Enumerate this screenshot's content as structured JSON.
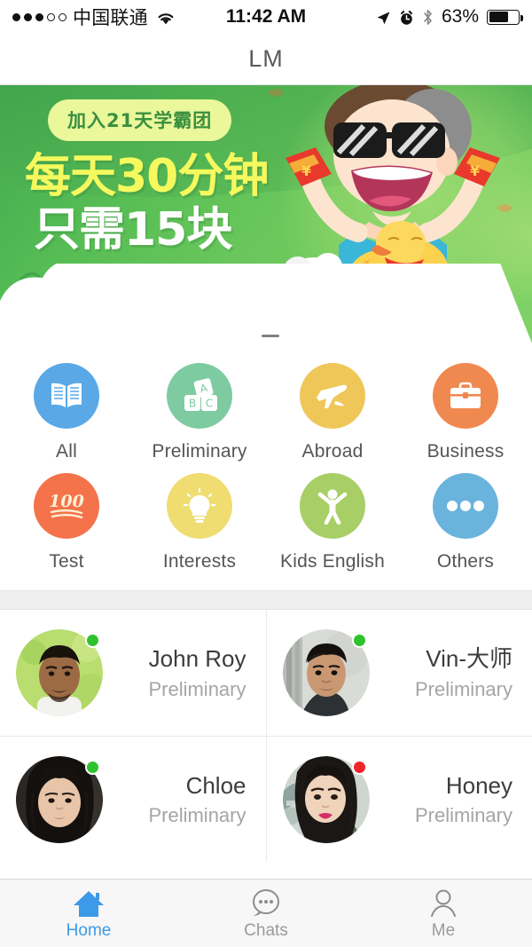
{
  "status_bar": {
    "signal_filled": 3,
    "signal_empty": 2,
    "carrier": "中国联通",
    "wifi_icon": "wifi-icon",
    "time": "11:42 AM",
    "location_icon": "location-arrow-icon",
    "alarm_icon": "alarm-clock-icon",
    "bluetooth_icon": "bluetooth-icon",
    "battery_percent": "63%",
    "battery_level": 63
  },
  "navbar": {
    "title": "LM"
  },
  "banner": {
    "pill_text": "加入21天学霸团",
    "headline_1": "每天30分钟",
    "headline_2": "只需15块",
    "pill_bg": "#eaf79b",
    "pill_color": "#3a8f3f",
    "headline_1_color": "#f5f95e",
    "headline_2_color": "#ffffff",
    "background_color": "#57bd55",
    "illustration": "boy-with-red-envelopes-sheep-duck-gold-coins",
    "page_indicator": "page-dash"
  },
  "categories": [
    [
      {
        "label": "All",
        "icon": "open-book-icon",
        "color": "#5aa9e6"
      },
      {
        "label": "Preliminary",
        "icon": "abc-blocks-icon",
        "color": "#7ecba2"
      },
      {
        "label": "Abroad",
        "icon": "airplane-icon",
        "color": "#efc758"
      },
      {
        "label": "Business",
        "icon": "briefcase-icon",
        "color": "#f0894f"
      }
    ],
    [
      {
        "label": "Test",
        "icon": "score-100-icon",
        "color": "#f4734a"
      },
      {
        "label": "Interests",
        "icon": "lightbulb-icon",
        "color": "#efdd72"
      },
      {
        "label": "Kids English",
        "icon": "child-figure-icon",
        "color": "#a8ce66"
      },
      {
        "label": "Others",
        "icon": "three-dots-icon",
        "color": "#69b3dd"
      }
    ]
  ],
  "contacts": [
    [
      {
        "name": "John Roy",
        "subtitle": "Preliminary",
        "status": "online",
        "status_color": "#2fc22f",
        "avatar": "photo-man-outdoors-green"
      },
      {
        "name": "Vin-大师",
        "subtitle": "Preliminary",
        "status": "online",
        "status_color": "#2fc22f",
        "avatar": "photo-man-dark-hair"
      }
    ],
    [
      {
        "name": "Chloe",
        "subtitle": "Preliminary",
        "status": "online",
        "status_color": "#2fc22f",
        "avatar": "photo-woman-long-hair"
      },
      {
        "name": "Honey",
        "subtitle": "Preliminary",
        "status": "busy",
        "status_color": "#f0262a",
        "avatar": "photo-woman-scarf"
      }
    ]
  ],
  "tabbar": {
    "active": "Home",
    "active_color": "#3d9ae8",
    "inactive_color": "#9a9a9a",
    "items": [
      {
        "label": "Home",
        "icon": "home-icon"
      },
      {
        "label": "Chats",
        "icon": "speech-bubble-icon"
      },
      {
        "label": "Me",
        "icon": "person-icon"
      }
    ]
  }
}
